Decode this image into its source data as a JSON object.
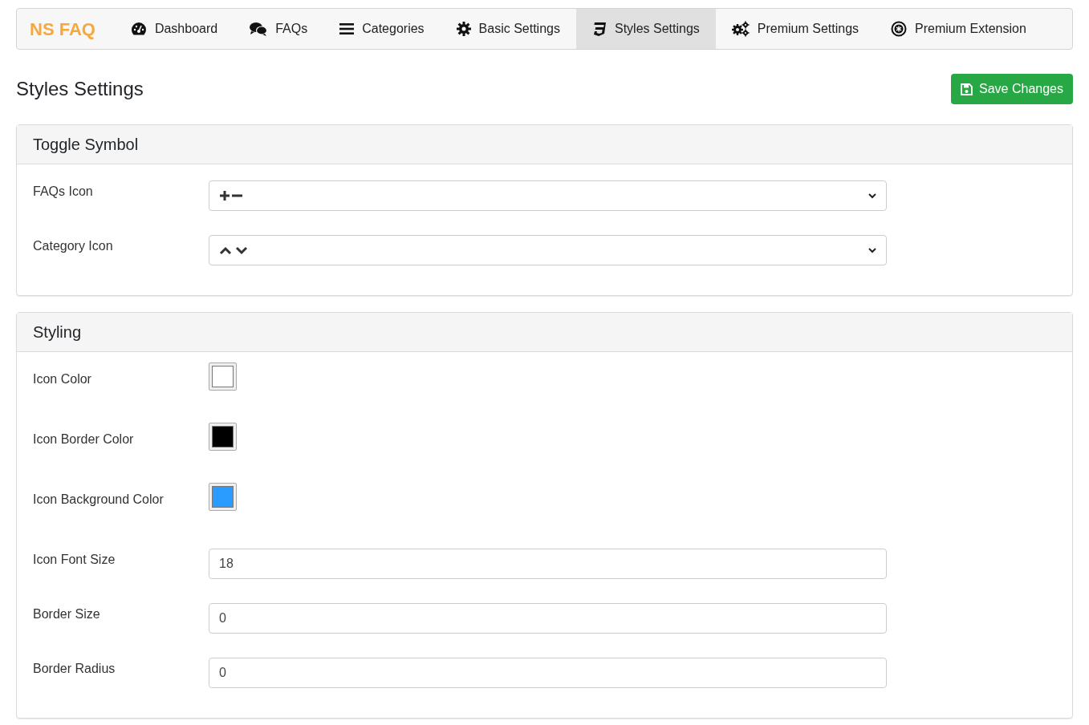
{
  "brand": "NS FAQ",
  "tabs": [
    {
      "label": "Dashboard",
      "selected": false
    },
    {
      "label": "FAQs",
      "selected": false
    },
    {
      "label": "Categories",
      "selected": false
    },
    {
      "label": "Basic Settings",
      "selected": false
    },
    {
      "label": "Styles Settings",
      "selected": true
    },
    {
      "label": "Premium Settings",
      "selected": false
    },
    {
      "label": "Premium Extension",
      "selected": false
    }
  ],
  "page_title": "Styles Settings",
  "save_button": "Save Changes",
  "sections": [
    {
      "title": "Toggle Symbol",
      "fields": [
        {
          "label": "FAQs Icon",
          "kind": "select"
        },
        {
          "label": "Category Icon",
          "kind": "select"
        }
      ]
    },
    {
      "title": "Styling",
      "fields": [
        {
          "label": "Icon Color",
          "kind": "color",
          "color": "#ffffff"
        },
        {
          "label": "Icon Border Color",
          "kind": "color",
          "color": "#000000"
        },
        {
          "label": "Icon Background Color",
          "kind": "color",
          "color": "#2a9bff"
        },
        {
          "label": "Icon Font Size",
          "kind": "text",
          "value": "18"
        },
        {
          "label": "Border Size",
          "kind": "text",
          "value": "0"
        },
        {
          "label": "Border Radius",
          "kind": "text",
          "value": "0"
        }
      ]
    }
  ]
}
